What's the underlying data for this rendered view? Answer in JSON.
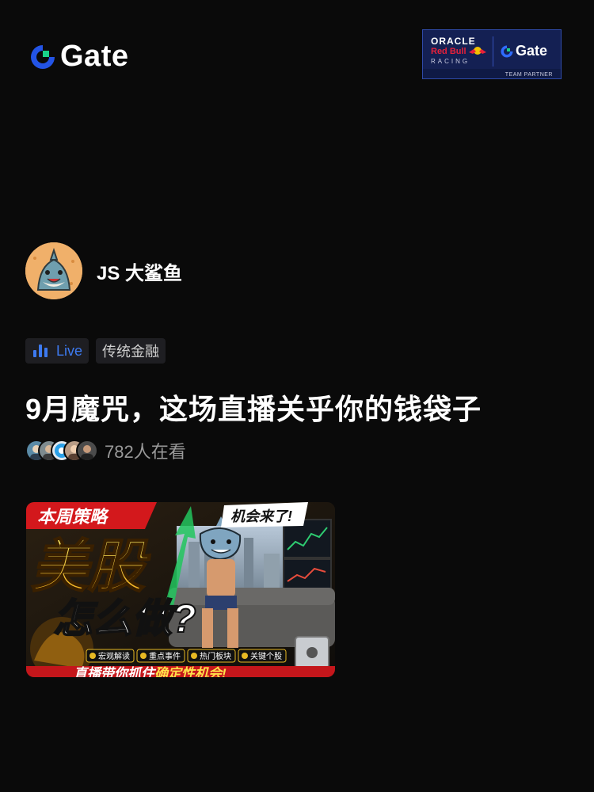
{
  "brand": {
    "name": "Gate",
    "accent": "#2354e6",
    "logo_icon": "gate-logo-icon"
  },
  "partner_badge": {
    "line1": "ORACLE",
    "line2": "Red Bull",
    "line3": "RACING",
    "gate": "Gate",
    "footer": "TEAM PARTNER"
  },
  "host": {
    "name": "JS 大鲨鱼",
    "avatar_icon": "shark-avatar"
  },
  "tags": [
    {
      "label": "Live",
      "icon": "bar-chart-icon",
      "color": "#3d7af0"
    },
    {
      "label": "传统金融"
    }
  ],
  "stream": {
    "title": "9月魔咒，这场直播关乎你的钱袋子",
    "viewer_count": "782人在看"
  },
  "thumbnail": {
    "headline_top": "本周策略",
    "badge": "机会来了!",
    "big_text_1": "美股",
    "big_text_2": "怎么做?",
    "chips": [
      "宏观解读",
      "重点事件",
      "热门板块",
      "关键个股"
    ],
    "footer_a": "直播带你抓住",
    "footer_b": "确定性机会!"
  }
}
